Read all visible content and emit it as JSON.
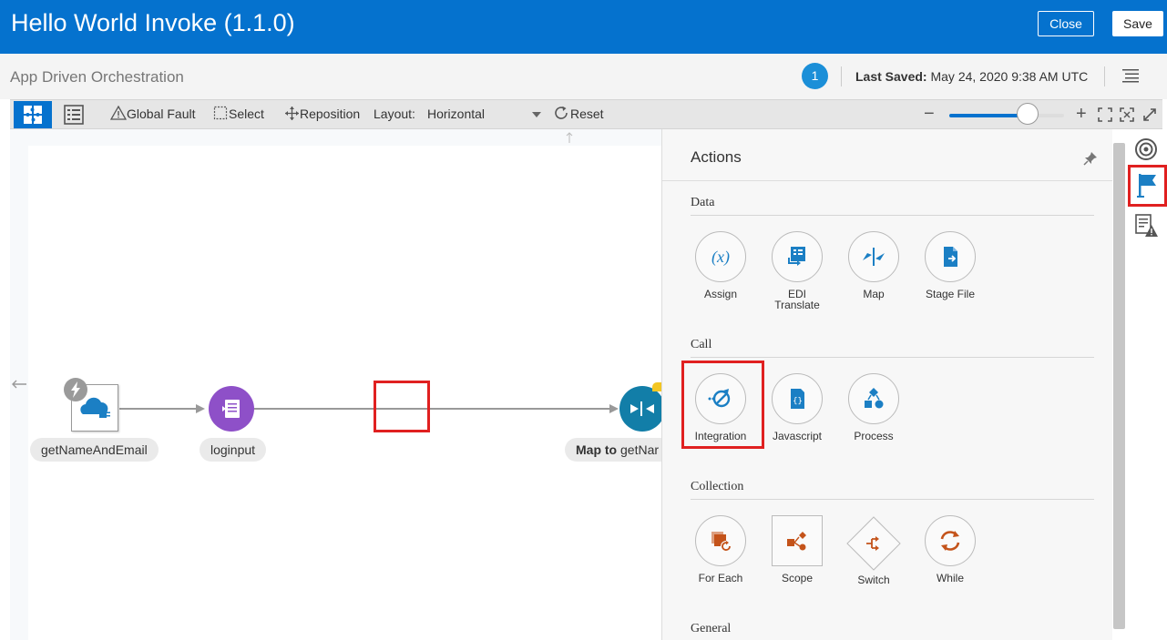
{
  "header": {
    "title": "Hello World Invoke (1.1.0)",
    "close_label": "Close",
    "save_label": "Save"
  },
  "subheader": {
    "subtitle": "App Driven Orchestration",
    "badge_count": "1",
    "last_saved_label": "Last Saved:",
    "last_saved_value": "May 24, 2020 9:38 AM UTC"
  },
  "toolbar": {
    "global_fault": "Global Fault",
    "select": "Select",
    "reposition": "Reposition",
    "layout_label": "Layout:",
    "layout_value": "Horizontal",
    "reset": "Reset",
    "zoom_minus": "−",
    "zoom_plus": "+",
    "zoom_level_fraction": 0.68
  },
  "canvas": {
    "nodes": [
      {
        "label": "getNameAndEmail"
      },
      {
        "label": "loginput"
      },
      {
        "label_bold": "Map to",
        "label_rest": " getNar"
      }
    ]
  },
  "actions": {
    "title": "Actions",
    "sections": [
      {
        "title": "Data",
        "items": [
          "Assign",
          "EDI Translate",
          "Map",
          "Stage File"
        ]
      },
      {
        "title": "Call",
        "items": [
          "Integration",
          "Javascript",
          "Process"
        ]
      },
      {
        "title": "Collection",
        "items": [
          "For Each",
          "Scope",
          "Switch",
          "While"
        ]
      },
      {
        "title": "General"
      }
    ],
    "edi_line1": "EDI",
    "edi_line2": "Translate",
    "assign_symbol": "(x)"
  },
  "colors": {
    "header": "#0572ce",
    "accent_blue": "#1b7fc4",
    "node_purple": "#8e50c8",
    "map_teal": "#127ea8",
    "orange_icon": "#c4531a",
    "highlight_red": "#e02020"
  },
  "icons": {
    "canvas_view": "puzzle-icon",
    "list_view": "list-icon",
    "rail": [
      "target-icon",
      "flag-icon",
      "error-list-icon"
    ]
  }
}
